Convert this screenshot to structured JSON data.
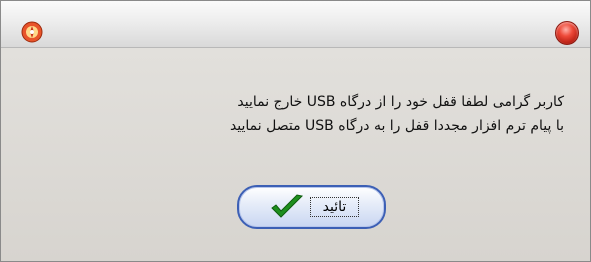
{
  "dialog": {
    "message_line1": "کاربر گرامی لطفا قفل خود را از درگاه USB  خارج نمایید",
    "message_line2": "با پیام ترم افزار مجددا قفل را به درگاه  USB متصل نمایید",
    "ok_label": "تائید"
  },
  "icons": {
    "app": "app-emblem-icon",
    "close": "close-icon",
    "ok": "check-icon"
  },
  "colors": {
    "close": "#e23b2e",
    "check": "#1e8f1e",
    "button_border": "#3c5fb5"
  }
}
